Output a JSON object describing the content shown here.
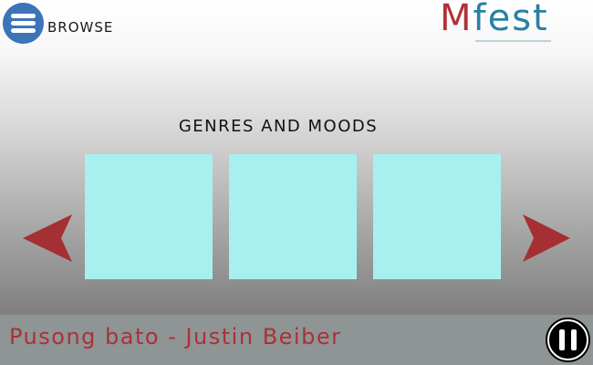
{
  "header": {
    "browse_label": "BROWSE",
    "logo_m": "M",
    "logo_rest": "fest"
  },
  "main": {
    "section_title": "GENRES AND MOODS",
    "tiles": [
      {
        "color": "#a8f0f0"
      },
      {
        "color": "#a8f0f0"
      },
      {
        "color": "#a8f0f0"
      }
    ],
    "arrow_color": "#a52f32"
  },
  "player": {
    "now_playing": "Pusong bato - Justin Beiber",
    "state_icon": "pause-icon"
  },
  "colors": {
    "menu_button": "#3d74b8",
    "logo_m": "#b03236",
    "logo_rest": "#2a7fa3",
    "now_playing_text": "#a93236",
    "player_bar": "#8f9494"
  }
}
